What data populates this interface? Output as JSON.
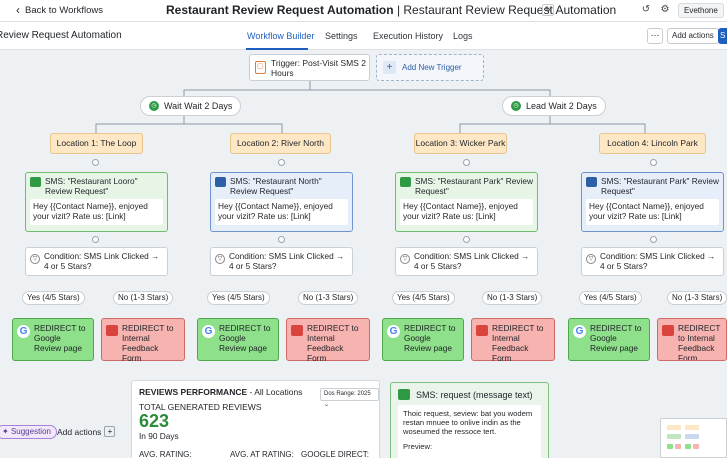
{
  "header": {
    "back_label": "Back to Workflows",
    "title_bold": "Restaurant Review Request Automation",
    "title_rest": " | Restaurant Review Request Automation",
    "user_label": "Evethone"
  },
  "nav": {
    "page_title": "Review Request Automation",
    "tabs": [
      "Workflow Builder",
      "Settings",
      "Execution History",
      "Logs"
    ],
    "active_tab": "Workflow Builder",
    "add_actions": "Add actions",
    "save_short": "S"
  },
  "trigger": {
    "label": "Trigger: Post-Visit SMS 2 Hours",
    "add_trigger": "Add New Trigger"
  },
  "waits": [
    {
      "label": "Wait Wait 2 Days"
    },
    {
      "label": "Lead Wait 2 Days"
    }
  ],
  "locations": [
    {
      "name": "Location 1: The Loop",
      "sms_title": "SMS: \"Restaurant Looro\" Review Request\"",
      "sms_body": "Hey {{Contact Name}}, enjoyed your vizit? Rate us: [Link]",
      "condition": "Condition: SMS Link Clicked → 4 or 5 Stars?",
      "yes": "Yes (4/5 Stars)",
      "no": "No (1-3 Stars)",
      "google": "REDIRECT to Google Review page",
      "internal": "REDIRECT to Internal Feedback Form"
    },
    {
      "name": "Location 2: River North",
      "sms_title": "SMS: \"Restaurant North\" Review Request\"",
      "sms_body": "Hey {{Contact Name}}, enjoyed your vizit? Rate us: [Link]",
      "condition": "Condition: SMS Link Clicked → 4 or 5 Stars?",
      "yes": "Yes (4/5 Stars)",
      "no": "No (1-3 Stars)",
      "google": "REDIRECT to Google Review page",
      "internal": "REDIRECT to Internal Feedback Form"
    },
    {
      "name": "Location 3: Wicker Park",
      "sms_title": "SMS: \"Restaurant Park\" Review Request\"",
      "sms_body": "Hey {{Contact Name}}, enjoyed your vizit? Rate us: [Link]",
      "condition": "Condition: SMS Link Clicked → 4 or 5 Stars?",
      "yes": "Yes (4/5 Stars)",
      "no": "No (1-3 Stars)",
      "google": "REDIRECT to Google Review page",
      "internal": "REDIRECT to Internal Feedback Form"
    },
    {
      "name": "Location 4: Lincoln Park",
      "sms_title": "SMS: \"Restaurant Park\" Review Request\"",
      "sms_body": "Hey {{Contact Name}}, enjoyed your vizit? Rate us: [Link]",
      "condition": "Condition: SMS Link Clicked → 4 or 5 Stars?",
      "yes": "Yes (4/5 Stars)",
      "no": "No (1-3 Stars)",
      "google": "REDIRECT to Google Review page",
      "internal": "REDIRECT to Internal Feedback Form"
    }
  ],
  "performance": {
    "title_bold": "REVIEWS PERFORMANCE",
    "title_rest": " - All Locations",
    "range": "Dos Range: 2025 ⌄",
    "total_label": "TOTAL GENERATED REVIEWS",
    "total_value": "623",
    "period": "In 90 Days",
    "col1": "AVG. RATING:",
    "col2": "AVG. AT RATING:",
    "col3": "GOOGLE DIRECT:"
  },
  "preview": {
    "title": "SMS: request (message text)",
    "body": "Thoic request, seview: bat you wodem restan mnuee to onlive indin as the woseumed the ressoce tert.",
    "preview_label": "Preview:"
  },
  "footer": {
    "suggestion": "Suggestion",
    "add_actions": "Add actions"
  },
  "colors": {
    "accent": "#1d5fbf",
    "google_green": "#8fe08a",
    "internal_red": "#f6b3b0",
    "location_tan": "#fde7c4"
  }
}
